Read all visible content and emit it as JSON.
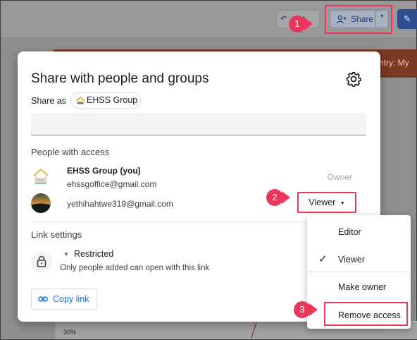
{
  "toolbar": {
    "reset_label": "set",
    "share_label": "Share"
  },
  "background": {
    "banner_text": "ntry: My",
    "chart_tick": "30%"
  },
  "dialog": {
    "title": "Share with people and groups",
    "share_as_prefix": "Share as",
    "share_as_group": "EHSS Group",
    "add_people_placeholder": "",
    "people_section_label": "People with access",
    "people": [
      {
        "name": "EHSS Group (you)",
        "email": "ehssgoffice@gmail.com",
        "role": "Owner"
      },
      {
        "name": "",
        "email": "yethihahtwe319@gmail.com",
        "role": "Viewer"
      }
    ],
    "link_section_label": "Link settings",
    "link_access": "Restricted",
    "link_description": "Only people added can open with this link",
    "copy_link_label": "Copy link"
  },
  "role_menu": {
    "items": [
      "Editor",
      "Viewer",
      "Make owner",
      "Remove access"
    ],
    "selected": "Viewer"
  },
  "steps": [
    "1",
    "2",
    "3"
  ],
  "colors": {
    "highlight": "#e8375a",
    "link_blue": "#1a73e8"
  }
}
